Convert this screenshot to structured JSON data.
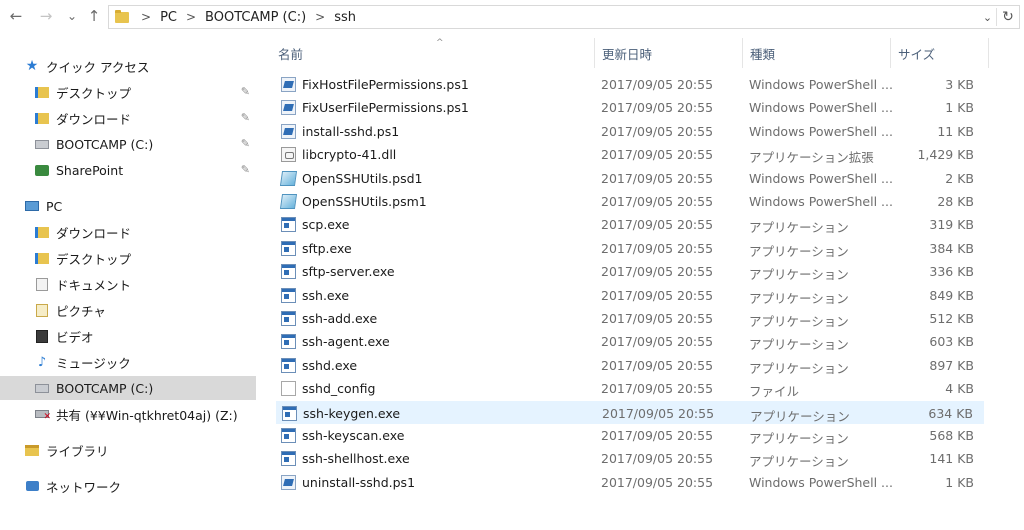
{
  "nav": {
    "back_glyph": "←",
    "forward_glyph": "→",
    "recent_glyph": "⌄",
    "up_glyph": "↑"
  },
  "address": {
    "crumbs": [
      "PC",
      "BOOTCAMP (C:)",
      "ssh"
    ],
    "separator": ">",
    "dropdown_glyph": "⌄",
    "refresh_glyph": "↻"
  },
  "sidebar": {
    "quick_access": "クイック アクセス",
    "quick_items": [
      "デスクトップ",
      "ダウンロード",
      "BOOTCAMP (C:)",
      "SharePoint"
    ],
    "pin_glyph": "📌",
    "pc": "PC",
    "pc_items": [
      "ダウンロード",
      "デスクトップ",
      "ドキュメント",
      "ピクチャ",
      "ビデオ",
      "ミュージック",
      "BOOTCAMP (C:)",
      "共有 (¥¥Win-qtkhret04aj) (Z:)"
    ],
    "libraries": "ライブラリ",
    "network": "ネットワーク"
  },
  "columns": {
    "name": "名前",
    "date": "更新日時",
    "type": "種類",
    "size": "サイズ",
    "sort_glyph": "^"
  },
  "files": [
    {
      "name": "FixHostFilePermissions.ps1",
      "date": "2017/09/05 20:55",
      "type": "Windows PowerShell ...",
      "size": "3 KB",
      "icon": "powershell-script-icon"
    },
    {
      "name": "FixUserFilePermissions.ps1",
      "date": "2017/09/05 20:55",
      "type": "Windows PowerShell ...",
      "size": "1 KB",
      "icon": "powershell-script-icon"
    },
    {
      "name": "install-sshd.ps1",
      "date": "2017/09/05 20:55",
      "type": "Windows PowerShell ...",
      "size": "11 KB",
      "icon": "powershell-script-icon"
    },
    {
      "name": "libcrypto-41.dll",
      "date": "2017/09/05 20:55",
      "type": "アプリケーション拡張",
      "size": "1,429 KB",
      "icon": "dll-icon"
    },
    {
      "name": "OpenSSHUtils.psd1",
      "date": "2017/09/05 20:55",
      "type": "Windows PowerShell ...",
      "size": "2 KB",
      "icon": "powershell-data-icon"
    },
    {
      "name": "OpenSSHUtils.psm1",
      "date": "2017/09/05 20:55",
      "type": "Windows PowerShell ...",
      "size": "28 KB",
      "icon": "powershell-data-icon"
    },
    {
      "name": "scp.exe",
      "date": "2017/09/05 20:55",
      "type": "アプリケーション",
      "size": "319 KB",
      "icon": "exe-icon"
    },
    {
      "name": "sftp.exe",
      "date": "2017/09/05 20:55",
      "type": "アプリケーション",
      "size": "384 KB",
      "icon": "exe-icon"
    },
    {
      "name": "sftp-server.exe",
      "date": "2017/09/05 20:55",
      "type": "アプリケーション",
      "size": "336 KB",
      "icon": "exe-icon"
    },
    {
      "name": "ssh.exe",
      "date": "2017/09/05 20:55",
      "type": "アプリケーション",
      "size": "849 KB",
      "icon": "exe-icon"
    },
    {
      "name": "ssh-add.exe",
      "date": "2017/09/05 20:55",
      "type": "アプリケーション",
      "size": "512 KB",
      "icon": "exe-icon"
    },
    {
      "name": "ssh-agent.exe",
      "date": "2017/09/05 20:55",
      "type": "アプリケーション",
      "size": "603 KB",
      "icon": "exe-icon"
    },
    {
      "name": "sshd.exe",
      "date": "2017/09/05 20:55",
      "type": "アプリケーション",
      "size": "897 KB",
      "icon": "exe-icon"
    },
    {
      "name": "sshd_config",
      "date": "2017/09/05 20:55",
      "type": "ファイル",
      "size": "4 KB",
      "icon": "file-icon"
    },
    {
      "name": "ssh-keygen.exe",
      "date": "2017/09/05 20:55",
      "type": "アプリケーション",
      "size": "634 KB",
      "icon": "exe-icon",
      "selected": true
    },
    {
      "name": "ssh-keyscan.exe",
      "date": "2017/09/05 20:55",
      "type": "アプリケーション",
      "size": "568 KB",
      "icon": "exe-icon"
    },
    {
      "name": "ssh-shellhost.exe",
      "date": "2017/09/05 20:55",
      "type": "アプリケーション",
      "size": "141 KB",
      "icon": "exe-icon"
    },
    {
      "name": "uninstall-sshd.ps1",
      "date": "2017/09/05 20:55",
      "type": "Windows PowerShell ...",
      "size": "1 KB",
      "icon": "powershell-script-icon"
    }
  ],
  "colors": {
    "selected_row": "#e5f3ff",
    "selected_nav": "#d9d9d9",
    "header_text": "#4c607a",
    "folder": "#e8c44f"
  }
}
